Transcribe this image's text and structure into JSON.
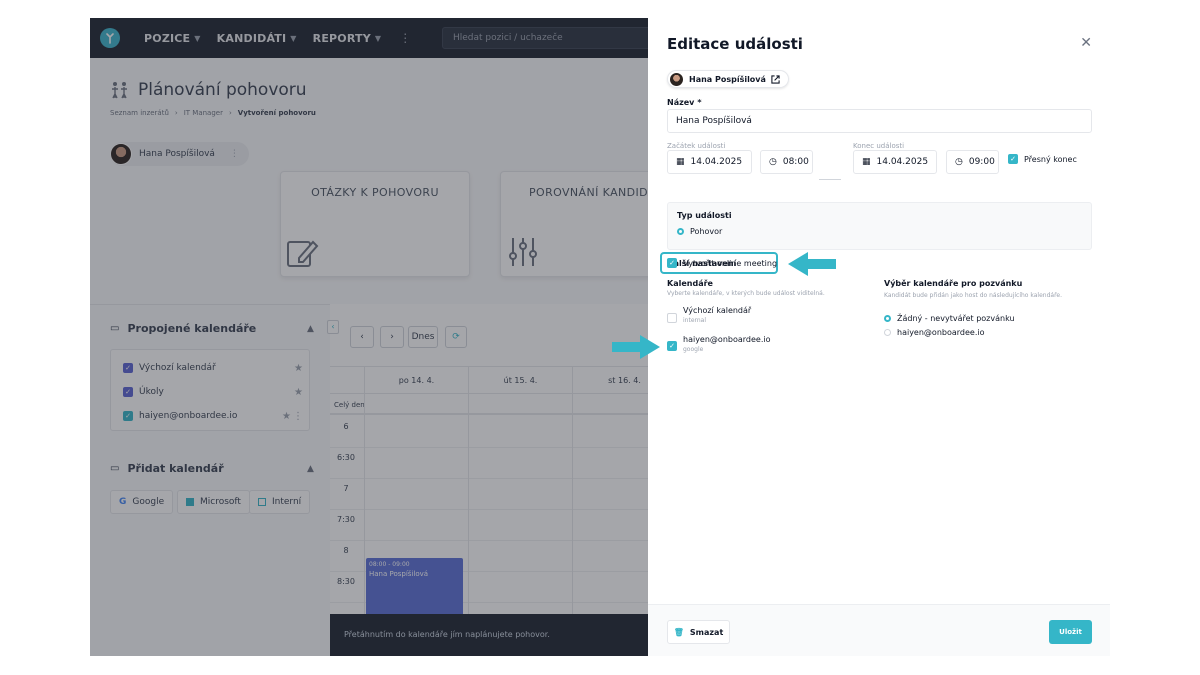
{
  "nav": {
    "items": [
      {
        "label": "POZICE"
      },
      {
        "label": "KANDIDÁTI"
      },
      {
        "label": "REPORTY"
      }
    ],
    "more": "⋮",
    "search_placeholder": "Hledat pozici / uchazeče"
  },
  "page": {
    "title": "Plánování pohovoru",
    "breadcrumbs": [
      "Seznam inzerátů",
      "IT Manager",
      "Vytvoření pohovoru"
    ],
    "candidate": "Hana Pospíšilová",
    "cards": [
      "OTÁZKY K POHOVORU",
      "POROVNÁNÍ KANDIDÁ"
    ]
  },
  "sidebar": {
    "linked_title": "Propojené kalendáře",
    "calendars": [
      {
        "label": "Výchozí kalendář"
      },
      {
        "label": "Úkoly"
      },
      {
        "label": "haiyen@onboardee.io"
      }
    ],
    "add_title": "Přidat kalendář",
    "providers": [
      {
        "label": "Google"
      },
      {
        "label": "Microsoft"
      },
      {
        "label": "Interní"
      }
    ]
  },
  "calendar": {
    "today": "Dnes",
    "days": [
      "po 14. 4.",
      "út 15. 4.",
      "st 16. 4."
    ],
    "all_day": "Celý den",
    "times": [
      "6",
      "6:30",
      "7",
      "7:30",
      "8",
      "8:30"
    ],
    "event": {
      "start": "08:00",
      "end": "09:00",
      "title": "Hana Pospíšilová"
    },
    "footer_hint": "Přetáhnutím do kalendáře jím naplánujete pohovor."
  },
  "dialog": {
    "title": "Editace události",
    "candidate": "Hana Pospíšilová",
    "name_label": "Název",
    "name_value": "Hana Pospíšilová",
    "start_label": "Začátek události",
    "start_date": "14.04.2025",
    "start_time": "08:00",
    "end_label": "Konec události",
    "end_date": "14.04.2025",
    "end_time": "09:00",
    "exact_end": "Přesný konec",
    "type_label": "Typ události",
    "type_value": "Pohovor",
    "more_settings": "Další nastavení",
    "online_meeting": "Vytvořit online meeting",
    "calendars_label": "Kalendáře",
    "calendars_hint": "Vyberte kalendáře, v kterých bude událost viditelná.",
    "cal_options": [
      {
        "name": "Výchozí kalendář",
        "source": "internal"
      },
      {
        "name": "haiyen@onboardee.io",
        "source": "google"
      }
    ],
    "invite_label": "Výběr kalendáře pro pozvánku",
    "invite_hint": "Kandidát bude přidán jako host do následujícího kalendáře.",
    "invite_options": [
      "Žádný - nevytvářet pozvánku",
      "haiyen@onboardee.io"
    ],
    "delete": "Smazat",
    "save": "Uložit"
  },
  "colors": {
    "accent": "#35b6c8",
    "navbar": "#1c2330",
    "event": "#5b6fd6",
    "checkbox": "#5b63d3"
  }
}
